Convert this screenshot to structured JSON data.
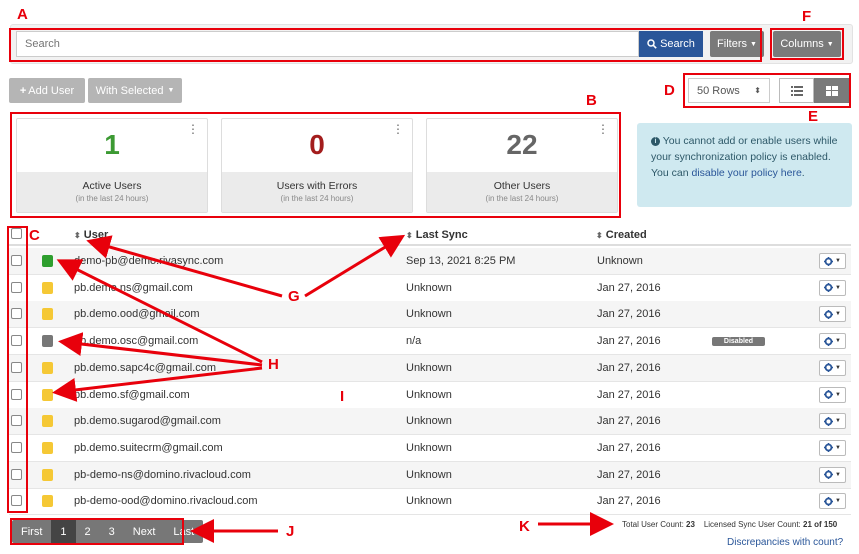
{
  "search": {
    "placeholder": "Search",
    "search_label": "Search",
    "filters_label": "Filters",
    "columns_label": "Columns"
  },
  "toolbar": {
    "add_user_label": "Add User",
    "with_selected_label": "With Selected",
    "rows_value": "50 Rows"
  },
  "cards": [
    {
      "value": "1",
      "label": "Active Users",
      "sub": "(in the last 24 hours)",
      "color": "#3c9a33"
    },
    {
      "value": "0",
      "label": "Users with Errors",
      "sub": "(in the last 24 hours)",
      "color": "#a31d1d"
    },
    {
      "value": "22",
      "label": "Other Users",
      "sub": "(in the last 24 hours)",
      "color": "#666666"
    }
  ],
  "alert": {
    "text": "You cannot add or enable users while your synchronization policy is enabled. You can ",
    "link": "disable your policy here",
    "end": "."
  },
  "table": {
    "headers": {
      "user": "User",
      "last_sync": "Last Sync",
      "created": "Created"
    },
    "rows": [
      {
        "user": "demo-pb@demo.rivasync.com",
        "last_sync": "Sep 13, 2021 8:25 PM",
        "created": "Unknown",
        "status": "green",
        "badge": ""
      },
      {
        "user": "pb.demo.ns@gmail.com",
        "last_sync": "Unknown",
        "created": "Jan 27, 2016",
        "status": "yellow",
        "badge": ""
      },
      {
        "user": "pb.demo.ood@gmail.com",
        "last_sync": "Unknown",
        "created": "Jan 27, 2016",
        "status": "yellow",
        "badge": ""
      },
      {
        "user": "pb.demo.osc@gmail.com",
        "last_sync": "n/a",
        "created": "Jan 27, 2016",
        "status": "gray",
        "badge": "Disabled"
      },
      {
        "user": "pb.demo.sapc4c@gmail.com",
        "last_sync": "Unknown",
        "created": "Jan 27, 2016",
        "status": "yellow",
        "badge": ""
      },
      {
        "user": "pb.demo.sf@gmail.com",
        "last_sync": "Unknown",
        "created": "Jan 27, 2016",
        "status": "yellow",
        "badge": ""
      },
      {
        "user": "pb.demo.sugarod@gmail.com",
        "last_sync": "Unknown",
        "created": "Jan 27, 2016",
        "status": "yellow",
        "badge": ""
      },
      {
        "user": "pb.demo.suitecrm@gmail.com",
        "last_sync": "Unknown",
        "created": "Jan 27, 2016",
        "status": "yellow",
        "badge": ""
      },
      {
        "user": "pb-demo-ns@domino.rivacloud.com",
        "last_sync": "Unknown",
        "created": "Jan 27, 2016",
        "status": "yellow",
        "badge": ""
      },
      {
        "user": "pb-demo-ood@domino.rivacloud.com",
        "last_sync": "Unknown",
        "created": "Jan 27, 2016",
        "status": "yellow",
        "badge": ""
      }
    ]
  },
  "pagination": {
    "pages": [
      "First",
      "1",
      "2",
      "3",
      "Next",
      "Last"
    ],
    "active": "1"
  },
  "footer": {
    "total_label": "Total User Count: ",
    "total_value": "23",
    "licensed_label": "Licensed Sync User Count: ",
    "licensed_value": "21 of 150",
    "discrepancies": "Discrepancies with count?"
  },
  "status_colors": {
    "green": "#2e9e2e",
    "yellow": "#f5c835",
    "gray": "#777777"
  },
  "annotations": {
    "letters": [
      "A",
      "B",
      "C",
      "D",
      "E",
      "F",
      "G",
      "H",
      "I",
      "J",
      "K"
    ],
    "color": "#e8000b"
  }
}
